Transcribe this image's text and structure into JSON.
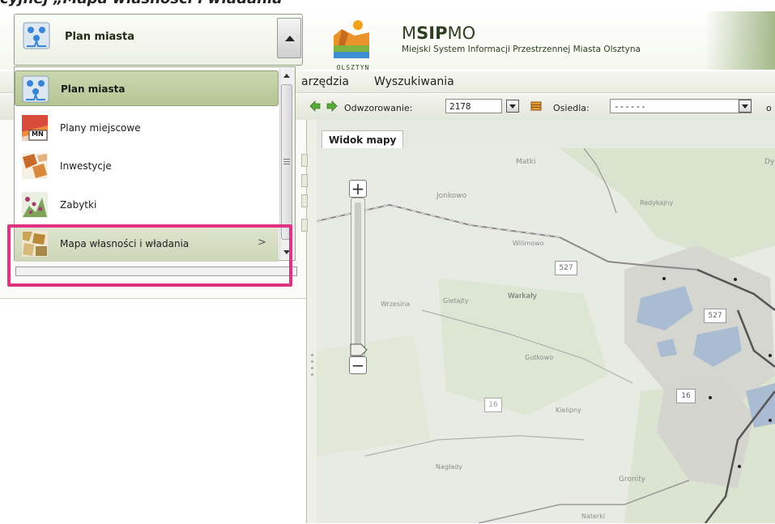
{
  "document": {
    "caption": "cyjnej „Mapa własności i władania”"
  },
  "header": {
    "logo_caption": "OLSZTYN",
    "app_name_prefix": "M",
    "app_name_bold": "SIP",
    "app_name_suffix": "MO",
    "subtitle": "Miejski System Informacji Przestrzennej Miasta Olsztyna"
  },
  "menu": {
    "items": [
      "arzędzia",
      "Wyszukiwania"
    ]
  },
  "toolbar": {
    "projection_label": "Odwzorowanie:",
    "projection_value": "2178",
    "district_label": "Osiedla:",
    "district_value": "------",
    "trailing_label": "o"
  },
  "selector": {
    "current": "Plan miasta"
  },
  "list": {
    "items": [
      {
        "label": "Plan miasta",
        "icon": "city-plan-icon",
        "selected": true
      },
      {
        "label": "Plany miejscowe",
        "icon": "local-plans-icon"
      },
      {
        "label": "Inwestycje",
        "icon": "investments-icon"
      },
      {
        "label": "Zabytki",
        "icon": "monuments-icon"
      },
      {
        "label": "Mapa własności i władania",
        "icon": "ownership-map-icon",
        "has_submenu": true,
        "chevron": ">"
      }
    ],
    "icon_text_mn": "MN"
  },
  "map": {
    "tab": "Widok mapy",
    "places": [
      "Matki",
      "Jonkowo",
      "Redykajny",
      "Wilimowo",
      "Warkały",
      "Gietajty",
      "Wrzesina",
      "Gutkowo",
      "Kielipny",
      "Nagłady",
      "Gronity",
      "Naterki",
      "Dy"
    ],
    "road_numbers": [
      "527",
      "527",
      "16",
      "16"
    ]
  },
  "colors": {
    "highlight": "#e23283",
    "accent_green": "#b7c595",
    "map_land": "#e6e9e2",
    "water": "#a9bcd1"
  }
}
